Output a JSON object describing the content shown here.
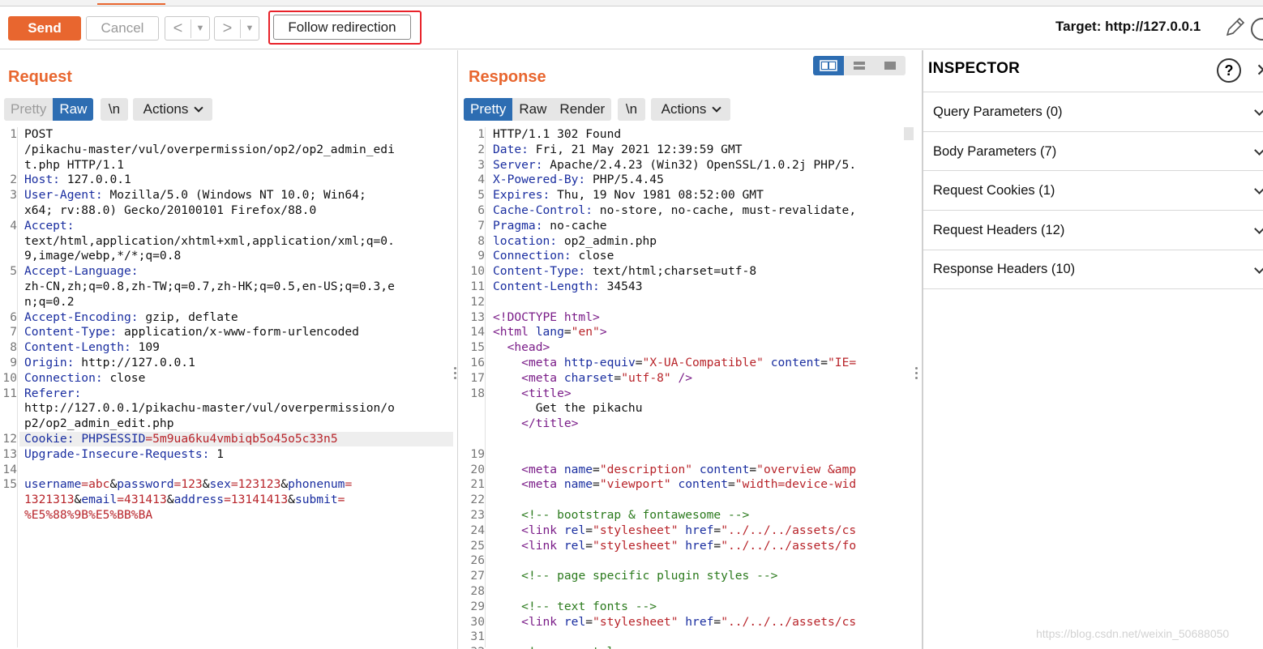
{
  "toolbar": {
    "send": "Send",
    "cancel": "Cancel",
    "back": "<",
    "forward": ">",
    "dropdown": "▼",
    "follow_redirection": "Follow redirection",
    "target": "Target: http://127.0.0.1"
  },
  "request": {
    "title": "Request",
    "tabs": [
      "Pretty",
      "Raw"
    ],
    "active_tab": "Raw",
    "newline_toggle": "\\n",
    "actions": "Actions",
    "line_numbers": [
      "1",
      "",
      "",
      "2",
      "3",
      "",
      "4",
      "",
      "",
      "5",
      "",
      "",
      "6",
      "7",
      "8",
      "9",
      "10",
      "11",
      "",
      "",
      "12",
      "13",
      "14",
      "15"
    ],
    "lines": [
      {
        "k": "",
        "v": "POST"
      },
      {
        "k": "",
        "v": "/pikachu-master/vul/overpermission/op2/op2_admin_edi"
      },
      {
        "k": "",
        "v": "t.php HTTP/1.1"
      },
      {
        "k": "Host:",
        "v": " 127.0.0.1"
      },
      {
        "k": "User-Agent:",
        "v": " Mozilla/5.0 (Windows NT 10.0; Win64;"
      },
      {
        "k": "",
        "v": "x64; rv:88.0) Gecko/20100101 Firefox/88.0"
      },
      {
        "k": "Accept:",
        "v": ""
      },
      {
        "k": "",
        "v": "text/html,application/xhtml+xml,application/xml;q=0."
      },
      {
        "k": "",
        "v": "9,image/webp,*/*;q=0.8"
      },
      {
        "k": "Accept-Language:",
        "v": ""
      },
      {
        "k": "",
        "v": "zh-CN,zh;q=0.8,zh-TW;q=0.7,zh-HK;q=0.5,en-US;q=0.3,e"
      },
      {
        "k": "",
        "v": "n;q=0.2"
      },
      {
        "k": "Accept-Encoding:",
        "v": " gzip, deflate"
      },
      {
        "k": "Content-Type:",
        "v": " application/x-www-form-urlencoded"
      },
      {
        "k": "Content-Length:",
        "v": " 109"
      },
      {
        "k": "Origin:",
        "v": " http://127.0.0.1"
      },
      {
        "k": "Connection:",
        "v": " close"
      },
      {
        "k": "Referer:",
        "v": ""
      },
      {
        "k": "",
        "v": "http://127.0.0.1/pikachu-master/vul/overpermission/o"
      },
      {
        "k": "",
        "v": "p2/op2_admin_edit.php"
      },
      {
        "k": "Cookie:",
        "v": " ",
        "k2": "PHPSESSID",
        "v2": "=5m9ua6ku4vmbiqb5o45o5c33n5"
      },
      {
        "k": "Upgrade-Insecure-Requests:",
        "v": " 1"
      },
      {
        "k": "",
        "v": ""
      },
      {
        "k": "",
        "v": "",
        "params": true
      }
    ],
    "body_line1": [
      {
        "t": "k",
        "s": "username"
      },
      {
        "t": "v",
        "s": "=abc"
      },
      {
        "t": "d",
        "s": "&"
      },
      {
        "t": "k",
        "s": "password"
      },
      {
        "t": "v",
        "s": "=123"
      },
      {
        "t": "d",
        "s": "&"
      },
      {
        "t": "k",
        "s": "sex"
      },
      {
        "t": "v",
        "s": "=123123"
      },
      {
        "t": "d",
        "s": "&"
      },
      {
        "t": "k",
        "s": "phonenum"
      },
      {
        "t": "v",
        "s": "="
      }
    ],
    "body_line2": [
      {
        "t": "v",
        "s": "1321313"
      },
      {
        "t": "d",
        "s": "&"
      },
      {
        "t": "k",
        "s": "email"
      },
      {
        "t": "v",
        "s": "=431413"
      },
      {
        "t": "d",
        "s": "&"
      },
      {
        "t": "k",
        "s": "address"
      },
      {
        "t": "v",
        "s": "=13141413"
      },
      {
        "t": "d",
        "s": "&"
      },
      {
        "t": "k",
        "s": "submit"
      },
      {
        "t": "v",
        "s": "="
      }
    ],
    "body_line3": [
      {
        "t": "v",
        "s": "%E5%88%9B%E5%BB%BA"
      }
    ]
  },
  "response": {
    "title": "Response",
    "tabs": [
      "Pretty",
      "Raw",
      "Render"
    ],
    "active_tab": "Pretty",
    "newline_toggle": "\\n",
    "actions": "Actions",
    "line_numbers": [
      "1",
      "2",
      "3",
      "4",
      "5",
      "6",
      "7",
      "8",
      "9",
      "10",
      "11",
      "12",
      "13",
      "14",
      "15",
      "16",
      "17",
      "18",
      "",
      "",
      "",
      "19",
      "20",
      "21",
      "22",
      "23",
      "24",
      "25",
      "26",
      "27",
      "28",
      "29",
      "30",
      "31",
      "32"
    ],
    "lines": [
      [
        {
          "t": "d",
          "s": "HTTP/1.1 302 Found"
        }
      ],
      [
        {
          "t": "k",
          "s": "Date:"
        },
        {
          "t": "d",
          "s": " Fri, 21 May 2021 12:39:59 GMT"
        }
      ],
      [
        {
          "t": "k",
          "s": "Server:"
        },
        {
          "t": "d",
          "s": " Apache/2.4.23 (Win32) OpenSSL/1.0.2j PHP/5."
        }
      ],
      [
        {
          "t": "k",
          "s": "X-Powered-By:"
        },
        {
          "t": "d",
          "s": " PHP/5.4.45"
        }
      ],
      [
        {
          "t": "k",
          "s": "Expires:"
        },
        {
          "t": "d",
          "s": " Thu, 19 Nov 1981 08:52:00 GMT"
        }
      ],
      [
        {
          "t": "k",
          "s": "Cache-Control:"
        },
        {
          "t": "d",
          "s": " no-store, no-cache, must-revalidate,"
        }
      ],
      [
        {
          "t": "k",
          "s": "Pragma:"
        },
        {
          "t": "d",
          "s": " no-cache"
        }
      ],
      [
        {
          "t": "k",
          "s": "location:"
        },
        {
          "t": "d",
          "s": " op2_admin.php"
        }
      ],
      [
        {
          "t": "k",
          "s": "Connection:"
        },
        {
          "t": "d",
          "s": " close"
        }
      ],
      [
        {
          "t": "k",
          "s": "Content-Type:"
        },
        {
          "t": "d",
          "s": " text/html;charset=utf-8"
        }
      ],
      [
        {
          "t": "k",
          "s": "Content-Length:"
        },
        {
          "t": "d",
          "s": " 34543"
        }
      ],
      [
        {
          "t": "d",
          "s": ""
        }
      ],
      [
        {
          "t": "tag",
          "s": "<!DOCTYPE html>"
        }
      ],
      [
        {
          "t": "tag",
          "s": "<html"
        },
        {
          "t": "k",
          "s": " lang"
        },
        {
          "t": "d",
          "s": "="
        },
        {
          "t": "v",
          "s": "\"en\""
        },
        {
          "t": "tag",
          "s": ">"
        }
      ],
      [
        {
          "t": "d",
          "s": "  "
        },
        {
          "t": "tag",
          "s": "<head>"
        }
      ],
      [
        {
          "t": "d",
          "s": "    "
        },
        {
          "t": "tag",
          "s": "<meta"
        },
        {
          "t": "k",
          "s": " http-equiv"
        },
        {
          "t": "d",
          "s": "="
        },
        {
          "t": "v",
          "s": "\"X-UA-Compatible\""
        },
        {
          "t": "k",
          "s": " content"
        },
        {
          "t": "d",
          "s": "="
        },
        {
          "t": "v",
          "s": "\"IE="
        }
      ],
      [
        {
          "t": "d",
          "s": "    "
        },
        {
          "t": "tag",
          "s": "<meta"
        },
        {
          "t": "k",
          "s": " charset"
        },
        {
          "t": "d",
          "s": "="
        },
        {
          "t": "v",
          "s": "\"utf-8\""
        },
        {
          "t": "tag",
          "s": " />"
        }
      ],
      [
        {
          "t": "d",
          "s": "    "
        },
        {
          "t": "tag",
          "s": "<title>"
        }
      ],
      [
        {
          "t": "d",
          "s": "      Get the pikachu"
        }
      ],
      [
        {
          "t": "d",
          "s": "    "
        },
        {
          "t": "tag",
          "s": "</title>"
        }
      ],
      [
        {
          "t": "d",
          "s": ""
        }
      ],
      [
        {
          "t": "d",
          "s": ""
        }
      ],
      [
        {
          "t": "d",
          "s": "    "
        },
        {
          "t": "tag",
          "s": "<meta"
        },
        {
          "t": "k",
          "s": " name"
        },
        {
          "t": "d",
          "s": "="
        },
        {
          "t": "v",
          "s": "\"description\""
        },
        {
          "t": "k",
          "s": " content"
        },
        {
          "t": "d",
          "s": "="
        },
        {
          "t": "v",
          "s": "\"overview &amp"
        }
      ],
      [
        {
          "t": "d",
          "s": "    "
        },
        {
          "t": "tag",
          "s": "<meta"
        },
        {
          "t": "k",
          "s": " name"
        },
        {
          "t": "d",
          "s": "="
        },
        {
          "t": "v",
          "s": "\"viewport\""
        },
        {
          "t": "k",
          "s": " content"
        },
        {
          "t": "d",
          "s": "="
        },
        {
          "t": "v",
          "s": "\"width=device-wid"
        }
      ],
      [
        {
          "t": "d",
          "s": ""
        }
      ],
      [
        {
          "t": "d",
          "s": "    "
        },
        {
          "t": "cm",
          "s": "<!-- bootstrap & fontawesome -->"
        }
      ],
      [
        {
          "t": "d",
          "s": "    "
        },
        {
          "t": "tag",
          "s": "<link"
        },
        {
          "t": "k",
          "s": " rel"
        },
        {
          "t": "d",
          "s": "="
        },
        {
          "t": "v",
          "s": "\"stylesheet\""
        },
        {
          "t": "k",
          "s": " href"
        },
        {
          "t": "d",
          "s": "="
        },
        {
          "t": "v",
          "s": "\"../../../assets/cs"
        }
      ],
      [
        {
          "t": "d",
          "s": "    "
        },
        {
          "t": "tag",
          "s": "<link"
        },
        {
          "t": "k",
          "s": " rel"
        },
        {
          "t": "d",
          "s": "="
        },
        {
          "t": "v",
          "s": "\"stylesheet\""
        },
        {
          "t": "k",
          "s": " href"
        },
        {
          "t": "d",
          "s": "="
        },
        {
          "t": "v",
          "s": "\"../../../assets/fo"
        }
      ],
      [
        {
          "t": "d",
          "s": ""
        }
      ],
      [
        {
          "t": "d",
          "s": "    "
        },
        {
          "t": "cm",
          "s": "<!-- page specific plugin styles -->"
        }
      ],
      [
        {
          "t": "d",
          "s": ""
        }
      ],
      [
        {
          "t": "d",
          "s": "    "
        },
        {
          "t": "cm",
          "s": "<!-- text fonts -->"
        }
      ],
      [
        {
          "t": "d",
          "s": "    "
        },
        {
          "t": "tag",
          "s": "<link"
        },
        {
          "t": "k",
          "s": " rel"
        },
        {
          "t": "d",
          "s": "="
        },
        {
          "t": "v",
          "s": "\"stylesheet\""
        },
        {
          "t": "k",
          "s": " href"
        },
        {
          "t": "d",
          "s": "="
        },
        {
          "t": "v",
          "s": "\"../../../assets/cs"
        }
      ],
      [
        {
          "t": "d",
          "s": ""
        }
      ],
      [
        {
          "t": "d",
          "s": "    "
        },
        {
          "t": "cm",
          "s": "<!-- ace styles -->"
        }
      ]
    ]
  },
  "inspector": {
    "title": "INSPECTOR",
    "help": "?",
    "close": "✕",
    "sections": [
      "Query Parameters (0)",
      "Body Parameters (7)",
      "Request Cookies (1)",
      "Request Headers (12)",
      "Response Headers (10)"
    ]
  },
  "watermark": "https://blog.csdn.net/weixin_50688050",
  "colors": {
    "accent": "#e8662f",
    "active_tab": "#2d6db2",
    "highlight": "#e8222a"
  }
}
